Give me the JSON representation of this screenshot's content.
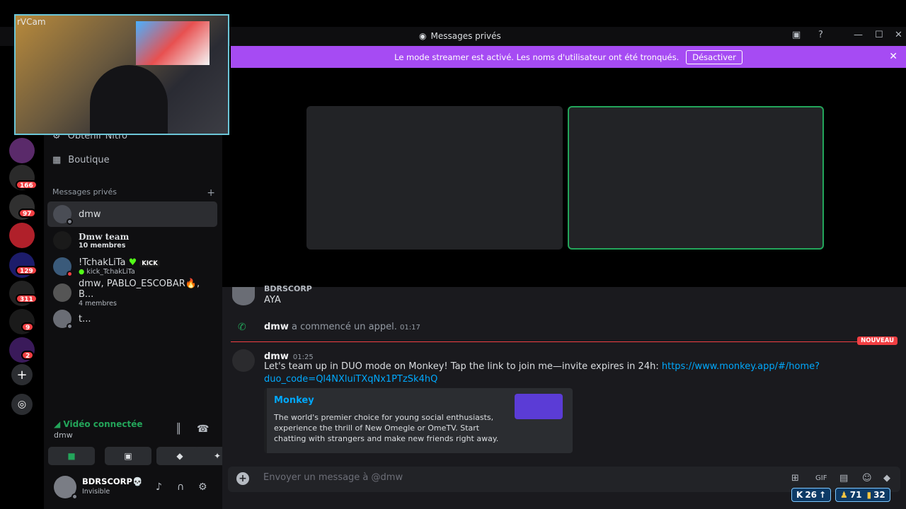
{
  "titlebar": {
    "title": "Messages privés"
  },
  "banner": {
    "text": "Le mode streamer est activé. Les noms d'utilisateur ont été tronqués.",
    "button": "Désactiver"
  },
  "webcam": {
    "label": "rVCam"
  },
  "rail": {
    "badges": [
      "166",
      "97",
      "129",
      "311",
      "9",
      "2"
    ]
  },
  "sidebar": {
    "nitro": "Obtenir Nitro",
    "shop": "Boutique",
    "dm_header": "Messages privés",
    "dms": [
      {
        "name": "dmw",
        "sub": ""
      },
      {
        "name": "Dmw team",
        "sub": "10 membres"
      },
      {
        "name": "!TchakLiTa",
        "sub": "kick_TchakLiTa",
        "tag": "KICK"
      },
      {
        "name": "dmw, PABLO_ESCOBAR🔥, B...",
        "sub": "4 membres"
      },
      {
        "name": "t...",
        "sub": ""
      }
    ]
  },
  "voice": {
    "status": "Vidéo connectée",
    "channel": "dmw"
  },
  "user": {
    "name": "BDRSCORP💀",
    "status": "Invisible"
  },
  "chat": {
    "prev_author": "BDRSCORP",
    "prev_text": "AYA",
    "call_author": "dmw",
    "call_text": "a commencé un appel.",
    "call_time": "01:17",
    "new_label": "NOUVEAU",
    "msg_author": "dmw",
    "msg_time": "01:25",
    "msg_text": "Let's team up in DUO mode on Monkey! Tap the link to join me—invite expires in 24h:",
    "msg_link_a": "https://www.monkey.app/#/home?",
    "msg_link_b": "duo_code=Ql4NXluiTXqNx1PTzSk4hQ",
    "embed_title": "Monkey",
    "embed_desc": "The world's premier choice for young social enthusiasts, experience the thrill of New Omegle or OmeTV. Start chatting with strangers and make new friends right away.",
    "composer_placeholder": "Envoyer un message à @dmw"
  },
  "stats": {
    "a": "26",
    "b": "71",
    "c": "32"
  }
}
